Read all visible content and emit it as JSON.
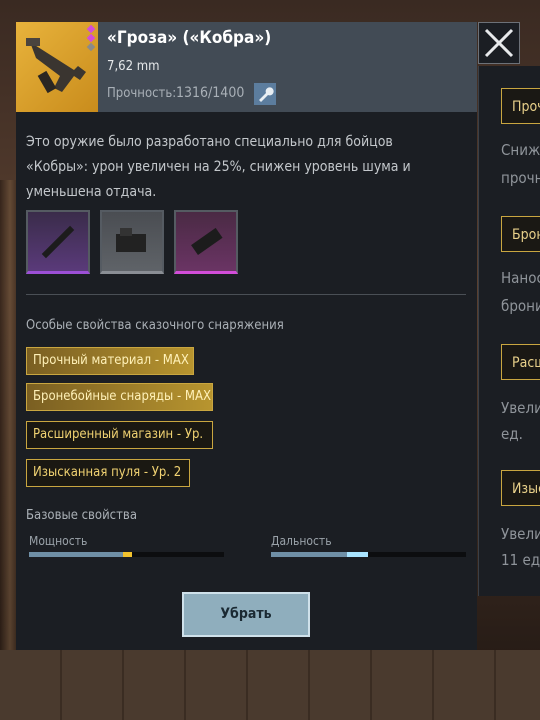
{
  "weapon": {
    "name": "«Гроза» («Кобра»)",
    "caliber": "7,62 mm",
    "durability_label": "Прочность:",
    "durability_value": "1316/1400",
    "description": "Это оружие было разработано специально для бойцов «Кобры»: урон увеличен на 25%, снижен уровень шума и уменьшена отдача."
  },
  "legendary_section": {
    "title": "Особые свойства сказочного снаряжения"
  },
  "perks": [
    "Прочный материал - MAX",
    "Бронебойные снаряды - MAX",
    "Расширенный магазин - Ур.",
    "Изысканная пуля - Ур. 2"
  ],
  "base_section": {
    "title": "Базовые свойства"
  },
  "stats": {
    "power": {
      "label": "Мощность",
      "value": 0.48,
      "bonus": 0.05
    },
    "range": {
      "label": "Дальность",
      "value": 0.39,
      "bonus": 0.11
    }
  },
  "buttons": {
    "remove": "Убрать"
  },
  "side_panel": {
    "chips": [
      "Прочн",
      "Броне",
      "Расш",
      "Изыс"
    ],
    "texts": [
      "Снижа",
      "прочн",
      "Нанос",
      "брони",
      "Увели",
      "ед.",
      "Увели",
      "11 ед."
    ]
  },
  "colors": {
    "gold": "#c9a640",
    "panel": "#1b1e23",
    "header": "#424b55"
  }
}
